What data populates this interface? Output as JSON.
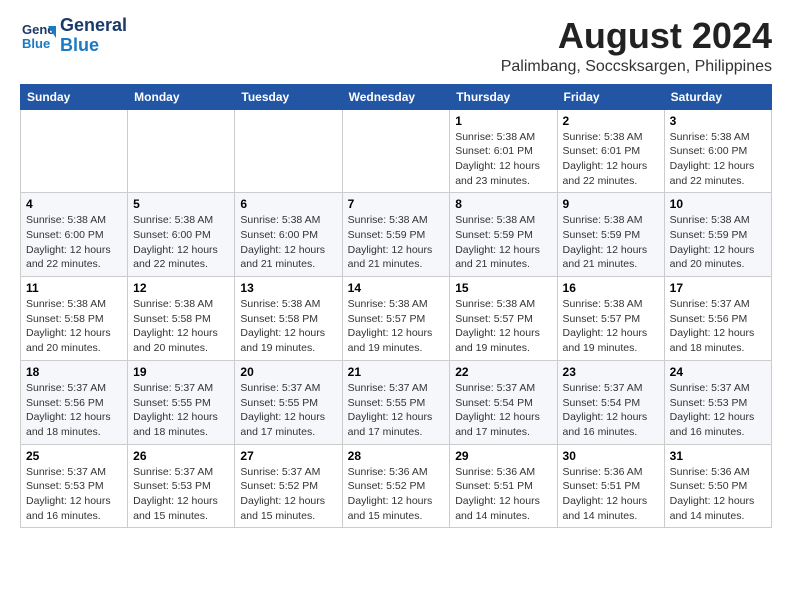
{
  "header": {
    "logo_line1": "General",
    "logo_line2": "Blue",
    "month_year": "August 2024",
    "location": "Palimbang, Soccsksargen, Philippines"
  },
  "weekdays": [
    "Sunday",
    "Monday",
    "Tuesday",
    "Wednesday",
    "Thursday",
    "Friday",
    "Saturday"
  ],
  "weeks": [
    [
      {
        "day": "",
        "info": ""
      },
      {
        "day": "",
        "info": ""
      },
      {
        "day": "",
        "info": ""
      },
      {
        "day": "",
        "info": ""
      },
      {
        "day": "1",
        "info": "Sunrise: 5:38 AM\nSunset: 6:01 PM\nDaylight: 12 hours\nand 23 minutes."
      },
      {
        "day": "2",
        "info": "Sunrise: 5:38 AM\nSunset: 6:01 PM\nDaylight: 12 hours\nand 22 minutes."
      },
      {
        "day": "3",
        "info": "Sunrise: 5:38 AM\nSunset: 6:00 PM\nDaylight: 12 hours\nand 22 minutes."
      }
    ],
    [
      {
        "day": "4",
        "info": "Sunrise: 5:38 AM\nSunset: 6:00 PM\nDaylight: 12 hours\nand 22 minutes."
      },
      {
        "day": "5",
        "info": "Sunrise: 5:38 AM\nSunset: 6:00 PM\nDaylight: 12 hours\nand 22 minutes."
      },
      {
        "day": "6",
        "info": "Sunrise: 5:38 AM\nSunset: 6:00 PM\nDaylight: 12 hours\nand 21 minutes."
      },
      {
        "day": "7",
        "info": "Sunrise: 5:38 AM\nSunset: 5:59 PM\nDaylight: 12 hours\nand 21 minutes."
      },
      {
        "day": "8",
        "info": "Sunrise: 5:38 AM\nSunset: 5:59 PM\nDaylight: 12 hours\nand 21 minutes."
      },
      {
        "day": "9",
        "info": "Sunrise: 5:38 AM\nSunset: 5:59 PM\nDaylight: 12 hours\nand 21 minutes."
      },
      {
        "day": "10",
        "info": "Sunrise: 5:38 AM\nSunset: 5:59 PM\nDaylight: 12 hours\nand 20 minutes."
      }
    ],
    [
      {
        "day": "11",
        "info": "Sunrise: 5:38 AM\nSunset: 5:58 PM\nDaylight: 12 hours\nand 20 minutes."
      },
      {
        "day": "12",
        "info": "Sunrise: 5:38 AM\nSunset: 5:58 PM\nDaylight: 12 hours\nand 20 minutes."
      },
      {
        "day": "13",
        "info": "Sunrise: 5:38 AM\nSunset: 5:58 PM\nDaylight: 12 hours\nand 19 minutes."
      },
      {
        "day": "14",
        "info": "Sunrise: 5:38 AM\nSunset: 5:57 PM\nDaylight: 12 hours\nand 19 minutes."
      },
      {
        "day": "15",
        "info": "Sunrise: 5:38 AM\nSunset: 5:57 PM\nDaylight: 12 hours\nand 19 minutes."
      },
      {
        "day": "16",
        "info": "Sunrise: 5:38 AM\nSunset: 5:57 PM\nDaylight: 12 hours\nand 19 minutes."
      },
      {
        "day": "17",
        "info": "Sunrise: 5:37 AM\nSunset: 5:56 PM\nDaylight: 12 hours\nand 18 minutes."
      }
    ],
    [
      {
        "day": "18",
        "info": "Sunrise: 5:37 AM\nSunset: 5:56 PM\nDaylight: 12 hours\nand 18 minutes."
      },
      {
        "day": "19",
        "info": "Sunrise: 5:37 AM\nSunset: 5:55 PM\nDaylight: 12 hours\nand 18 minutes."
      },
      {
        "day": "20",
        "info": "Sunrise: 5:37 AM\nSunset: 5:55 PM\nDaylight: 12 hours\nand 17 minutes."
      },
      {
        "day": "21",
        "info": "Sunrise: 5:37 AM\nSunset: 5:55 PM\nDaylight: 12 hours\nand 17 minutes."
      },
      {
        "day": "22",
        "info": "Sunrise: 5:37 AM\nSunset: 5:54 PM\nDaylight: 12 hours\nand 17 minutes."
      },
      {
        "day": "23",
        "info": "Sunrise: 5:37 AM\nSunset: 5:54 PM\nDaylight: 12 hours\nand 16 minutes."
      },
      {
        "day": "24",
        "info": "Sunrise: 5:37 AM\nSunset: 5:53 PM\nDaylight: 12 hours\nand 16 minutes."
      }
    ],
    [
      {
        "day": "25",
        "info": "Sunrise: 5:37 AM\nSunset: 5:53 PM\nDaylight: 12 hours\nand 16 minutes."
      },
      {
        "day": "26",
        "info": "Sunrise: 5:37 AM\nSunset: 5:53 PM\nDaylight: 12 hours\nand 15 minutes."
      },
      {
        "day": "27",
        "info": "Sunrise: 5:37 AM\nSunset: 5:52 PM\nDaylight: 12 hours\nand 15 minutes."
      },
      {
        "day": "28",
        "info": "Sunrise: 5:36 AM\nSunset: 5:52 PM\nDaylight: 12 hours\nand 15 minutes."
      },
      {
        "day": "29",
        "info": "Sunrise: 5:36 AM\nSunset: 5:51 PM\nDaylight: 12 hours\nand 14 minutes."
      },
      {
        "day": "30",
        "info": "Sunrise: 5:36 AM\nSunset: 5:51 PM\nDaylight: 12 hours\nand 14 minutes."
      },
      {
        "day": "31",
        "info": "Sunrise: 5:36 AM\nSunset: 5:50 PM\nDaylight: 12 hours\nand 14 minutes."
      }
    ]
  ]
}
